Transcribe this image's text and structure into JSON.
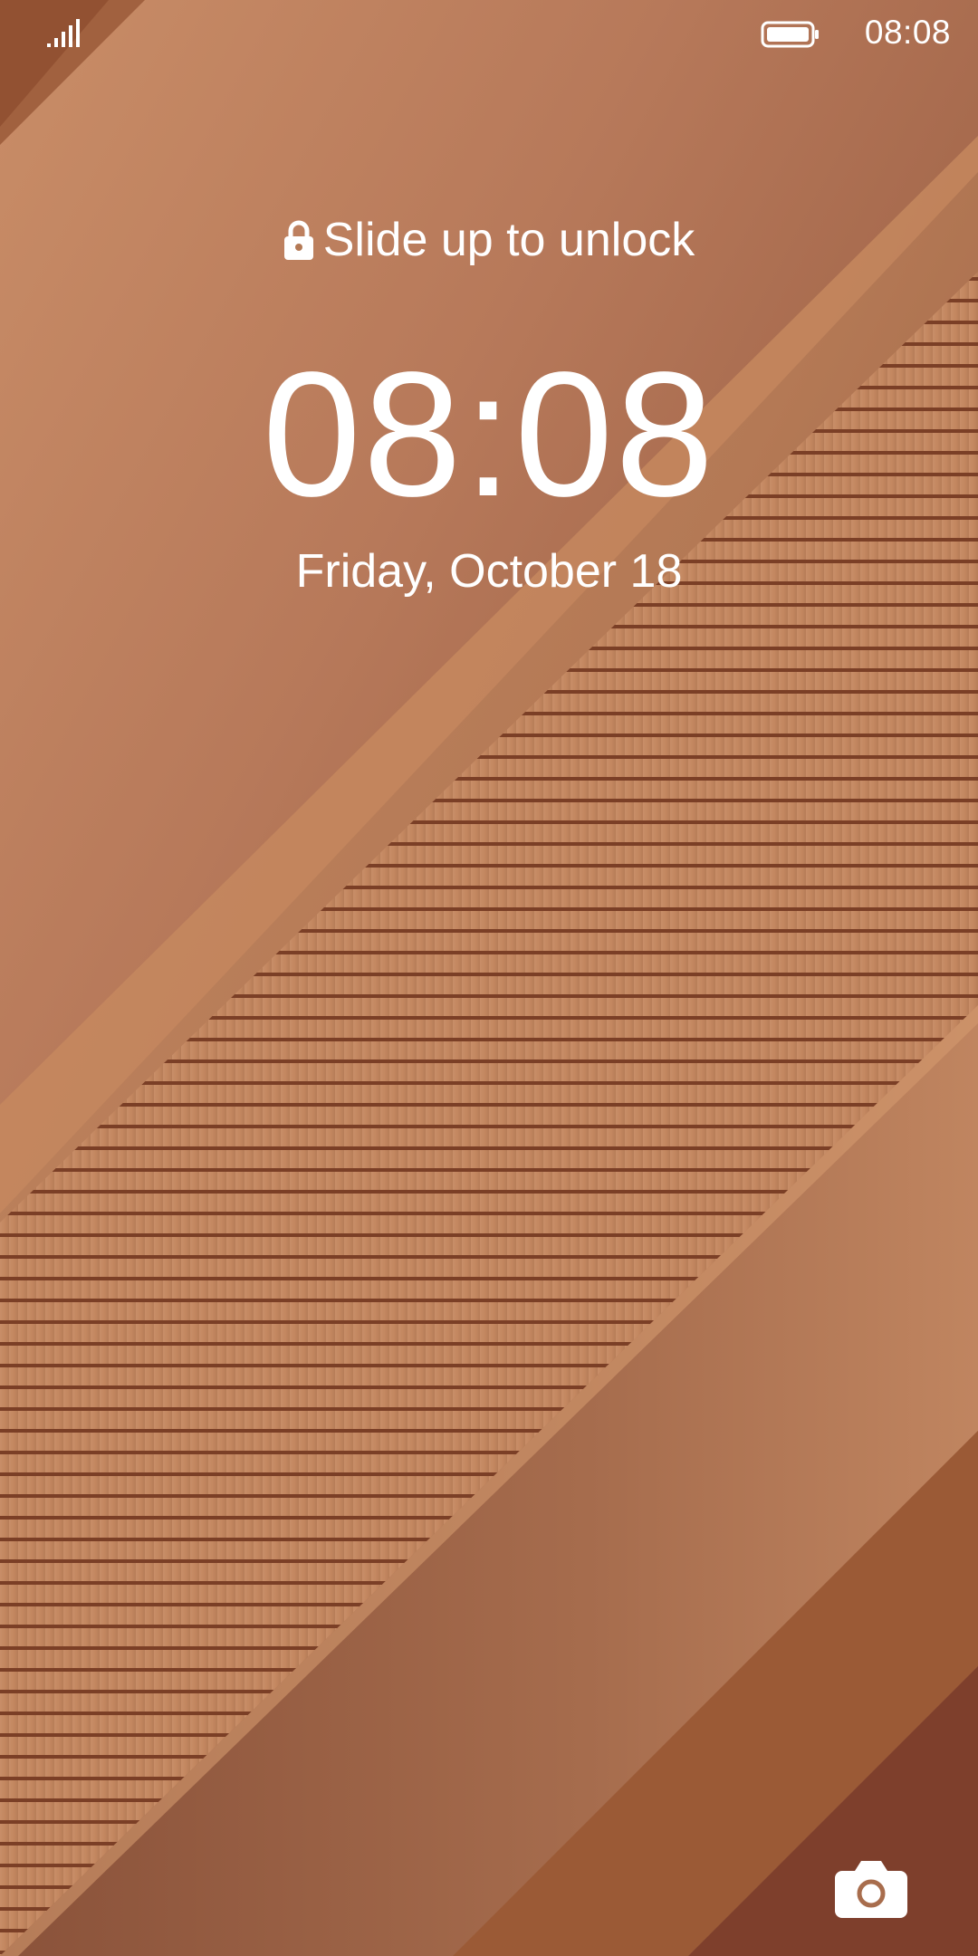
{
  "status_bar": {
    "time": "08:08",
    "signal_icon": "signal-icon",
    "battery_icon": "battery-icon"
  },
  "lockscreen": {
    "unlock_hint": "Slide up to unlock",
    "lock_icon": "lock-icon",
    "clock": "08:08",
    "date": "Friday, October 18",
    "camera_icon": "camera-icon"
  },
  "colors": {
    "wallpaper_base": "#b57a56",
    "wallpaper_light": "#c98c63",
    "wallpaper_dark": "#7a3f2a",
    "stripe": "#8a4a2c",
    "text": "#ffffff"
  }
}
